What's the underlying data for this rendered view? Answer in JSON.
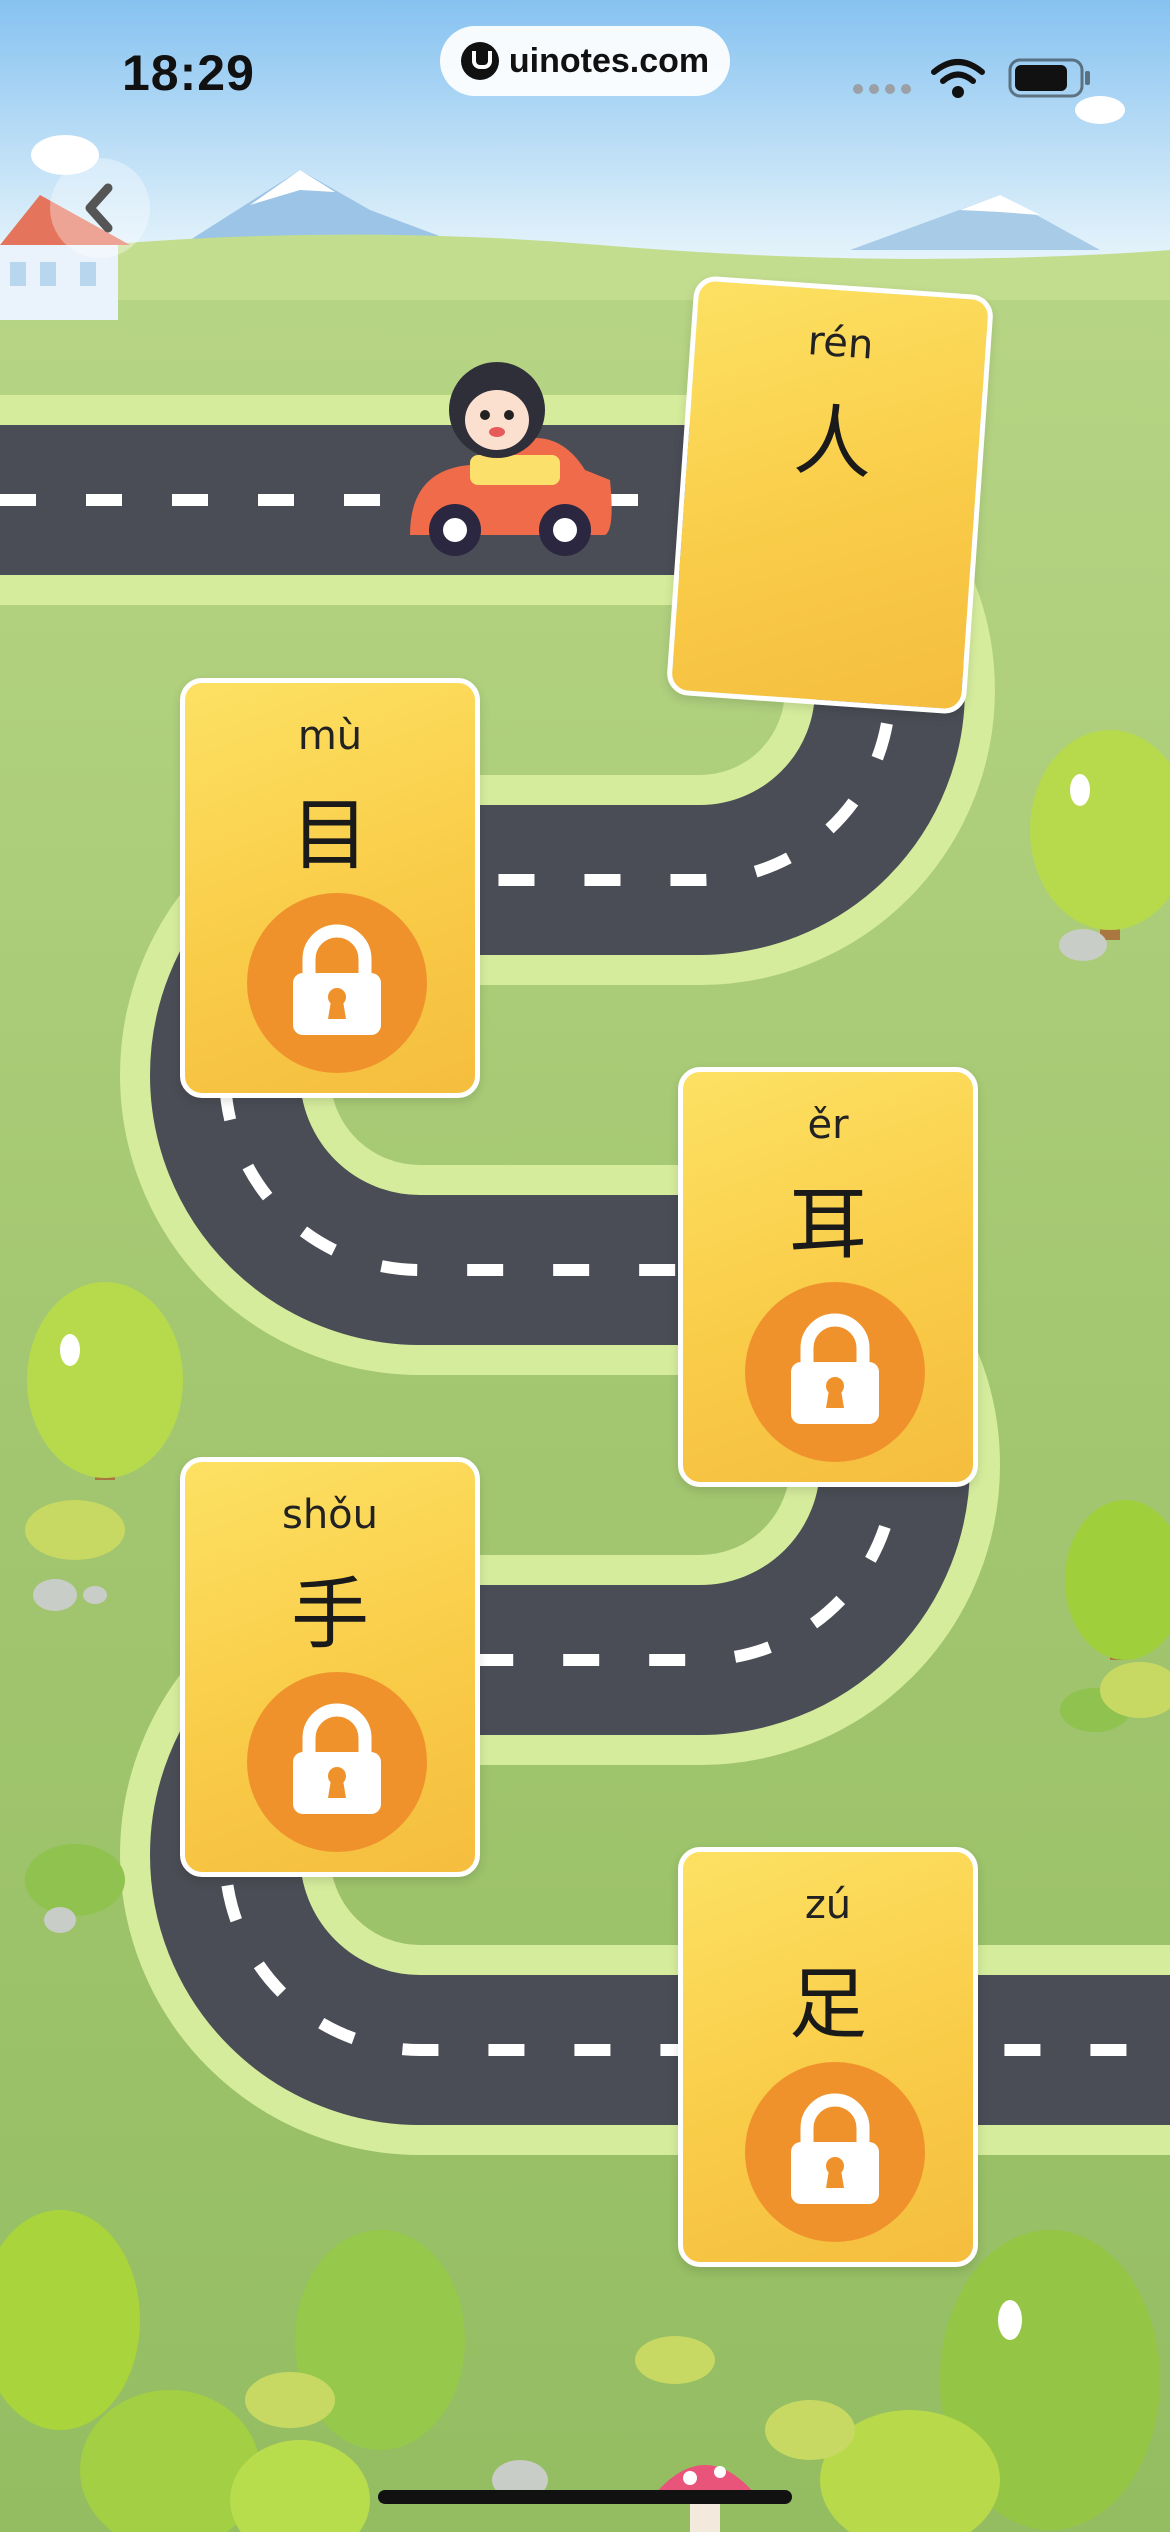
{
  "status_bar": {
    "time": "18:29",
    "url": "uinotes.com"
  },
  "cards": [
    {
      "pinyin": "rén",
      "hanzi": "人",
      "state": "unlocked",
      "icon": "boy-walking-picture"
    },
    {
      "pinyin": "mù",
      "hanzi": "目",
      "state": "locked",
      "icon": "lock-icon"
    },
    {
      "pinyin": "ěr",
      "hanzi": "耳",
      "state": "locked",
      "icon": "lock-icon"
    },
    {
      "pinyin": "shǒu",
      "hanzi": "手",
      "state": "locked",
      "icon": "lock-icon"
    },
    {
      "pinyin": "zú",
      "hanzi": "足",
      "state": "locked",
      "icon": "lock-icon"
    }
  ],
  "colors": {
    "sky": "#8fc6f0",
    "grass": "#a9cd75",
    "road": "#4a4d55",
    "road_edge": "#d7ef9f",
    "card": "#f9cc48",
    "lock": "#f0922c"
  }
}
